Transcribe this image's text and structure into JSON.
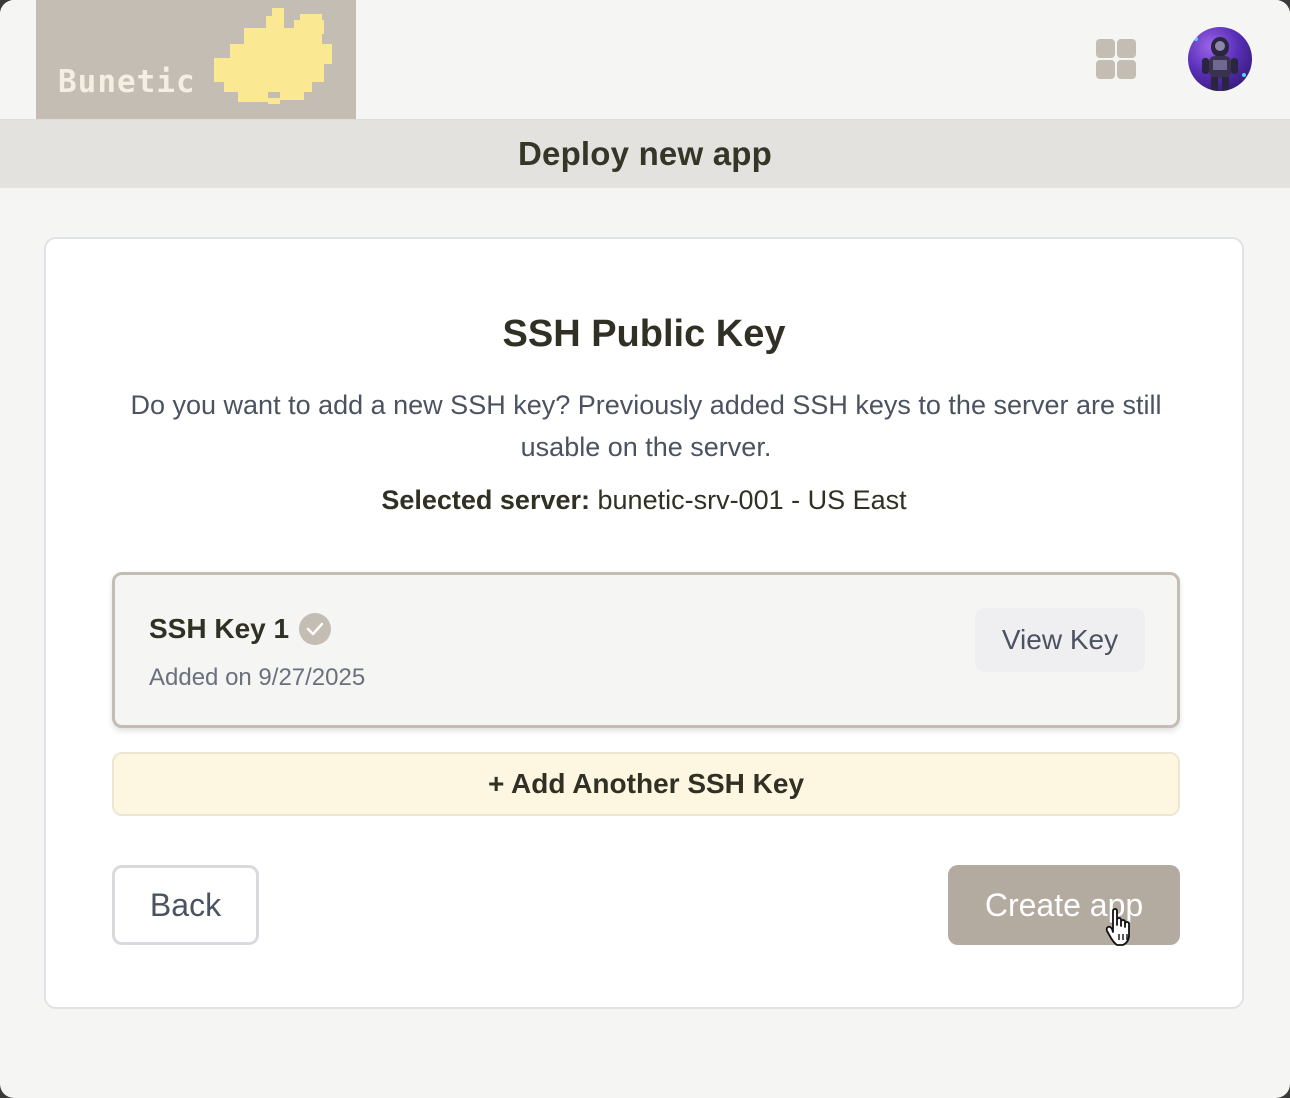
{
  "brand": {
    "name": "Bunetic",
    "logo_bg_color": "#c3bdb3",
    "mascot_color": "#fbe893"
  },
  "header": {
    "apps_icon": "grid-icon",
    "avatar": "user-avatar"
  },
  "page": {
    "title": "Deploy new app"
  },
  "card": {
    "title": "SSH Public Key",
    "description": "Do you want to add a new SSH key? Previously added SSH keys to the server are still usable on the server.",
    "selected_label": "Selected server:",
    "selected_value": "bunetic-srv-001 - US East"
  },
  "ssh_keys": [
    {
      "name": "SSH Key 1",
      "status_icon": "check-circle-icon",
      "added": "Added on 9/27/2025",
      "action": "View Key"
    }
  ],
  "add_key_label": "+ Add Another SSH Key",
  "actions": {
    "back": "Back",
    "create": "Create app"
  },
  "colors": {
    "primary_button": "#b3aaa0",
    "add_key_bg": "#fdf7e1",
    "key_border": "#c3bdb3"
  }
}
